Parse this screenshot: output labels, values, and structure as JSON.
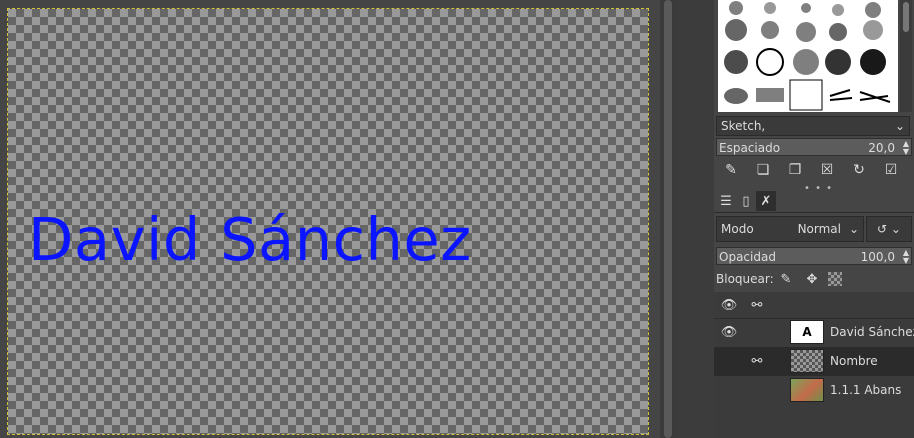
{
  "canvas": {
    "text": "David Sánchez",
    "text_color": "#0a14ff"
  },
  "brushes": {
    "selected_name": "Sketch,",
    "spacing_label": "Espaciado",
    "spacing_value": "20,0"
  },
  "brush_actions": [
    "edit-brush-icon",
    "new-brush-icon",
    "duplicate-brush-icon",
    "delete-brush-icon",
    "refresh-brushes-icon",
    "open-as-image-icon"
  ],
  "dock_tabs": [
    "layers-tab",
    "channels-tab",
    "paths-tab"
  ],
  "layers": {
    "mode_label": "Modo",
    "mode_value": "Normal",
    "opacity_label": "Opacidad",
    "opacity_value": "100,0",
    "lock_label": "Bloquear:",
    "items": [
      {
        "name": "David Sánchez",
        "visible": true,
        "linked": false,
        "type": "text",
        "selected": false
      },
      {
        "name": "Nombre",
        "visible": false,
        "linked": true,
        "type": "transparent",
        "selected": true
      },
      {
        "name": "1.1.1 Abans",
        "visible": false,
        "linked": false,
        "type": "image",
        "selected": false
      }
    ]
  }
}
